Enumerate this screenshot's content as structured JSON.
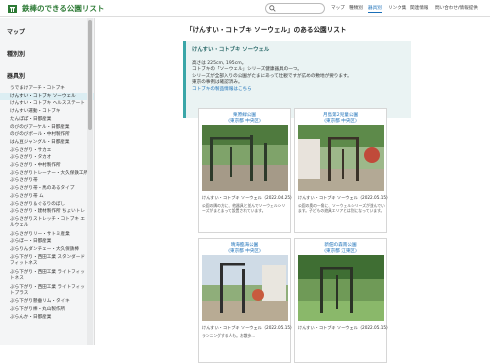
{
  "header": {
    "site_title": "鉄棒のできる公園リスト",
    "nav": [
      "マップ",
      "種類別",
      "器具別",
      "リンク集",
      "関連情報",
      "問い合わせ/情報提供"
    ],
    "active_nav": "器具別"
  },
  "sidebar": {
    "section_map": "マップ",
    "section_type": "種別別",
    "section_equipment": "器具別",
    "items": [
      {
        "label": "うでまけアーチ・コトブキ"
      },
      {
        "label": "けんすい・コトブキ ソーウェル",
        "selected": true
      },
      {
        "label": "けんすい・コトブキ ヘルスステート"
      },
      {
        "label": "けんすい運動・コトブキ"
      },
      {
        "label": "たんぽぽ・日都産業"
      },
      {
        "label": "のびのびアーケル・日都産業"
      },
      {
        "label": "のびのびポール・中村製作所"
      },
      {
        "label": "はん豆ジャングル・日都産業"
      },
      {
        "label": "ぶらさがり・サカエ"
      },
      {
        "label": "ぶらさがり・タカオ"
      },
      {
        "label": "ぶらさがり・中村製作所"
      },
      {
        "label": "ぶらさがりトレーナー・大久保鉄工所"
      },
      {
        "label": "ぶらさがり帯"
      },
      {
        "label": "ぶらさがり帯・馬のあるタイプ"
      },
      {
        "label": "ぶらさがり帯 ム"
      },
      {
        "label": "ぶらさがり＆ぐるりのぼし"
      },
      {
        "label": "ぶらさがり・建材製作所 ちょいトレ"
      },
      {
        "label": "ぶらさがりストレッチ・コトブキ エルウェル",
        "wrap": true
      },
      {
        "label": "ぶらさがりリー・サトミ産業"
      },
      {
        "label": "ぶらぼー・日都産業"
      },
      {
        "label": "ぶらりんダンチェー・大久保鉄棒"
      },
      {
        "label": "ぶら下がり・西田工業 スタンダードフィットネス",
        "wrap": true
      },
      {
        "label": "ぶら下がり・西田工業 ライトフィットネス",
        "wrap": true
      },
      {
        "label": "ぶら下がり・西田工業 ライトフィットプラス",
        "wrap": true
      },
      {
        "label": "ぶら下がり懸垂リム・タイキ"
      },
      {
        "label": "ぶら下がり棒・丸山製作所"
      },
      {
        "label": "ぶらんか・日都産業"
      }
    ]
  },
  "main": {
    "title": "「けんすい・コトブキ ソーウェル」のある公園リスト",
    "info": {
      "title": "けんすい・コトブキ ソーウェル",
      "lines": [
        "高さは 225cm, 195cm。",
        "コトブキの「ソーウェル」シリーズ健康器具の一つ。",
        "シリーズが全部入りの公園がたまにあって壮観ですが広めの敷地が要ります。",
        "東京の事例は確認済み。"
      ],
      "link": "コトブキの製品情報はこちら"
    },
    "cards": [
      {
        "name": "栗原緑公園",
        "location": "(東京都 中央区)",
        "meta": "けんすい・コトブキ ソーウェル（2022.04.25）",
        "desc": "公園の隅の方に、他器具と並んでソーウェルシリーズがまとまって設置されています。"
      },
      {
        "name": "月島第2児童公園",
        "location": "(東京都 中央区)",
        "meta": "けんすい・コトブキ ソーウェル（2022.05.15）",
        "desc": "公園の奥の一角に、ソーウェルシリーズが並んでいます。子どもの遊具エリアとは別になっています。"
      },
      {
        "name": "晴海臨海公園",
        "location": "(東京都 中央区)",
        "meta": "けんすい・コトブキ ソーウェル（2022.05.15）",
        "desc": "ランニングする人も。お散歩…"
      },
      {
        "name": "新佃の森南公園",
        "location": "(東京都 江東区)",
        "meta": "けんすい・コトブキ ソーウェル（2022.05.15）",
        "desc": ""
      }
    ]
  },
  "colors": {
    "accent": "#1a6fb8",
    "brand": "#2d7a35",
    "info_bg": "#eaf3f3",
    "info_border": "#3aa6a8"
  }
}
